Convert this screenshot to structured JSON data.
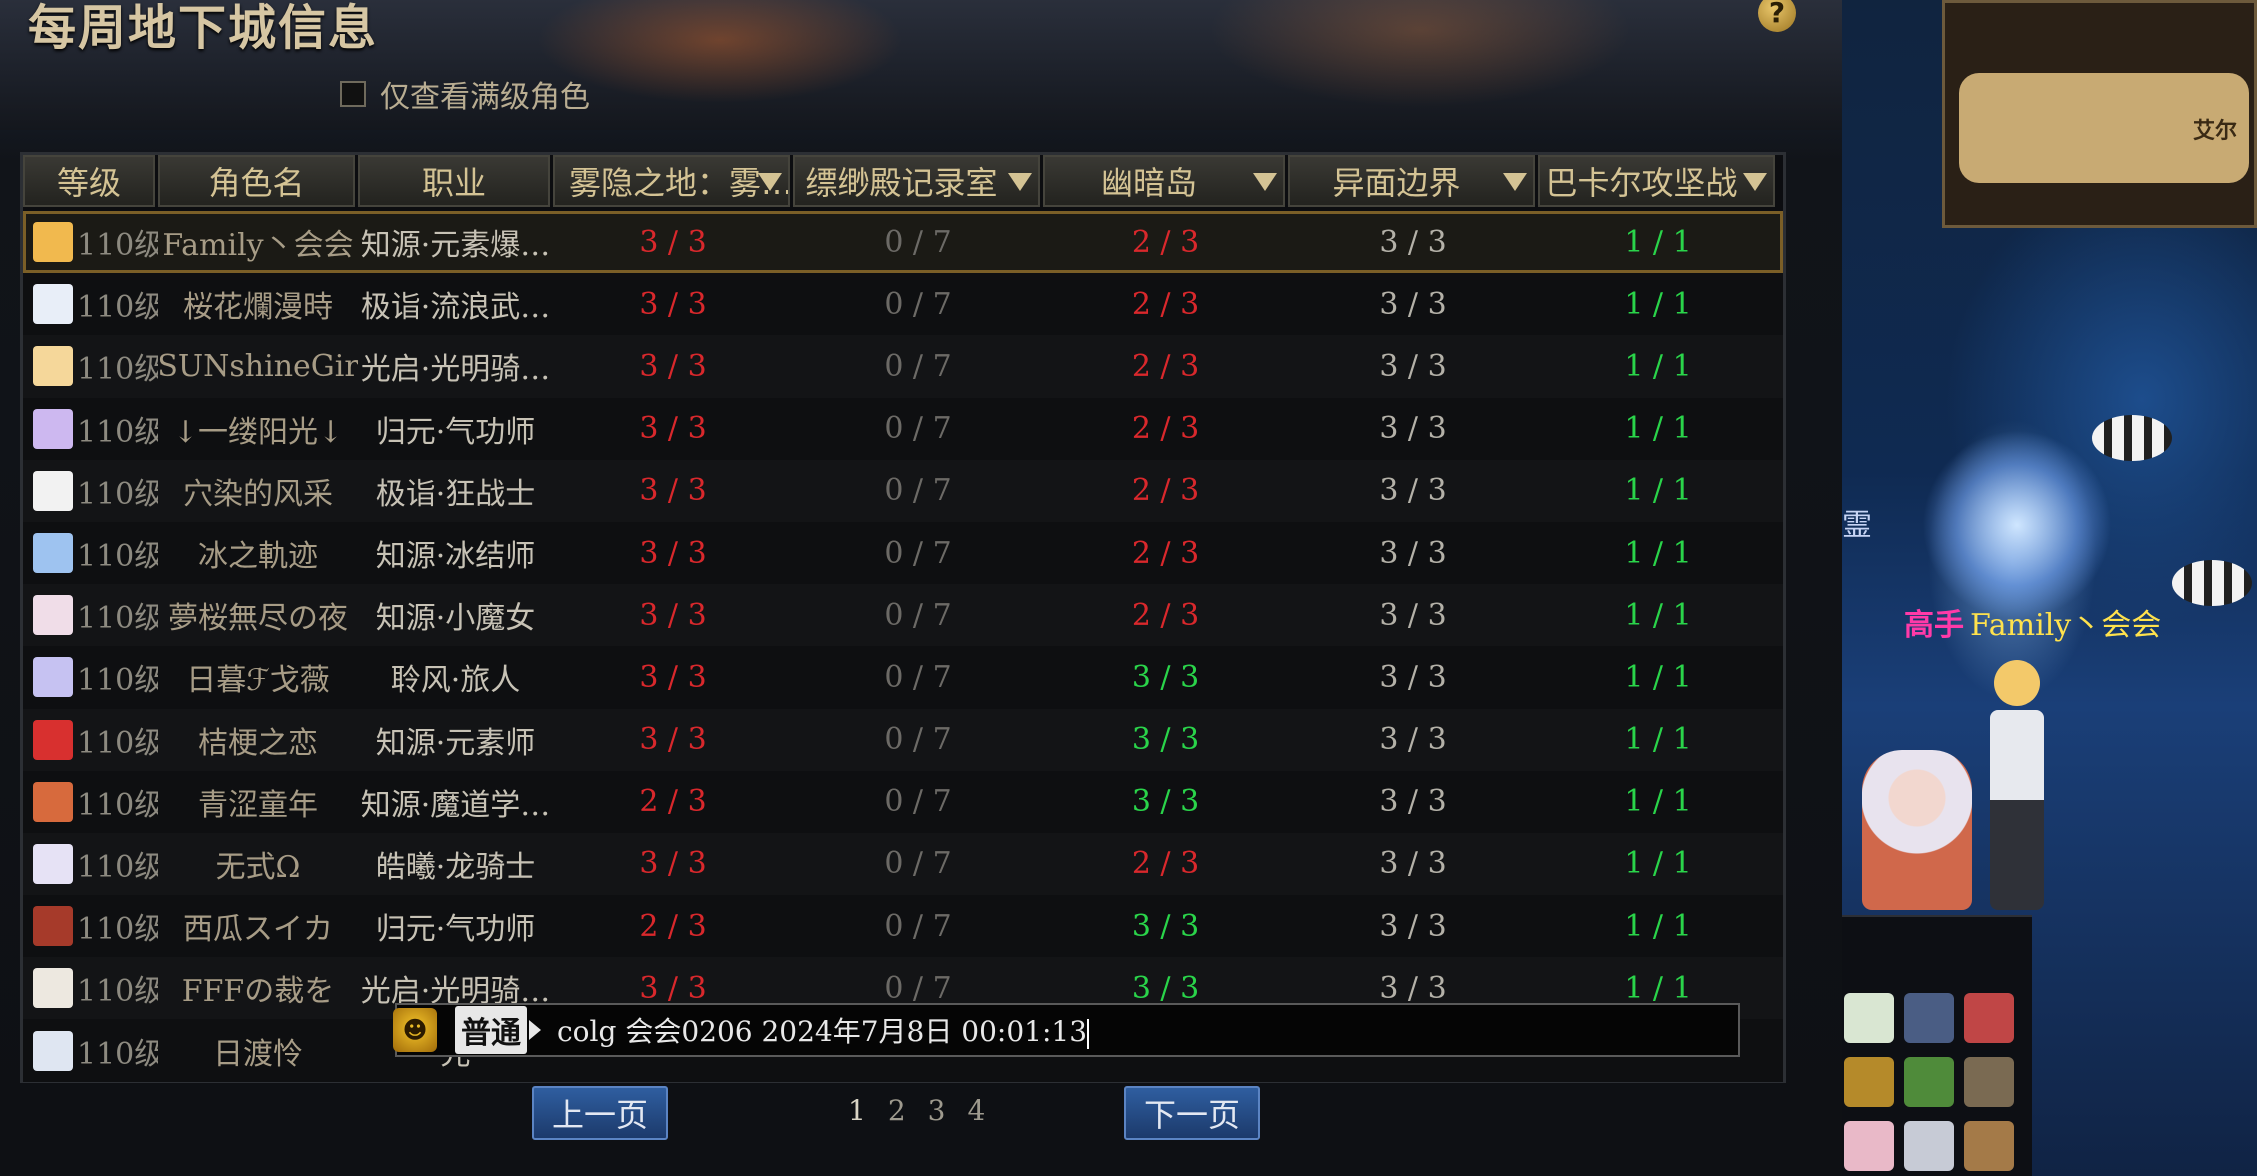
{
  "window": {
    "title": "每周地下城信息",
    "help_label": "?"
  },
  "filter": {
    "label": "仅查看满级角色",
    "checked": false
  },
  "table": {
    "columns": [
      {
        "label": "等级",
        "sortable": false
      },
      {
        "label": "角色名",
        "sortable": false
      },
      {
        "label": "职业",
        "sortable": false
      },
      {
        "label": "雾隐之地：雾…",
        "sortable": true
      },
      {
        "label": "缥缈殿记录室",
        "sortable": true
      },
      {
        "label": "幽暗岛",
        "sortable": true
      },
      {
        "label": "异面边界",
        "sortable": true
      },
      {
        "label": "巴卡尔攻坚战",
        "sortable": true
      }
    ],
    "rows": [
      {
        "level": "110级",
        "name": "Family丶会会",
        "job": "知源·元素爆…",
        "d1": "3 / 3",
        "d1c": "red",
        "d2": "0 / 7",
        "d3": "2 / 3",
        "d3c": "red",
        "d4": "3 / 3",
        "d5": "1 / 1",
        "avatar": "#f1b94e",
        "selected": true
      },
      {
        "level": "110级",
        "name": "桜花爛漫時",
        "job": "极诣·流浪武…",
        "d1": "3 / 3",
        "d1c": "red",
        "d2": "0 / 7",
        "d3": "2 / 3",
        "d3c": "red",
        "d4": "3 / 3",
        "d5": "1 / 1",
        "avatar": "#e8eef8"
      },
      {
        "level": "110级",
        "name": "SUNshineGir",
        "job": "光启·光明骑…",
        "d1": "3 / 3",
        "d1c": "red",
        "d2": "0 / 7",
        "d3": "2 / 3",
        "d3c": "red",
        "d4": "3 / 3",
        "d5": "1 / 1",
        "avatar": "#f5d79a"
      },
      {
        "level": "110级",
        "name": "↓一缕阳光↓",
        "job": "归元·气功师",
        "d1": "3 / 3",
        "d1c": "red",
        "d2": "0 / 7",
        "d3": "2 / 3",
        "d3c": "red",
        "d4": "3 / 3",
        "d5": "1 / 1",
        "avatar": "#cdb8f0"
      },
      {
        "level": "110级",
        "name": "穴染的风采",
        "job": "极诣·狂战士",
        "d1": "3 / 3",
        "d1c": "red",
        "d2": "0 / 7",
        "d3": "2 / 3",
        "d3c": "red",
        "d4": "3 / 3",
        "d5": "1 / 1",
        "avatar": "#f2f2f2"
      },
      {
        "level": "110级",
        "name": "冰之軌迹",
        "job": "知源·冰结师",
        "d1": "3 / 3",
        "d1c": "red",
        "d2": "0 / 7",
        "d3": "2 / 3",
        "d3c": "red",
        "d4": "3 / 3",
        "d5": "1 / 1",
        "avatar": "#9ec3f0"
      },
      {
        "level": "110级",
        "name": "夢桜無尽の夜",
        "job": "知源·小魔女",
        "d1": "3 / 3",
        "d1c": "red",
        "d2": "0 / 7",
        "d3": "2 / 3",
        "d3c": "red",
        "d4": "3 / 3",
        "d5": "1 / 1",
        "avatar": "#f0dde8"
      },
      {
        "level": "110级",
        "name": "日暮ℱ戈薇",
        "job": "聆风·旅人",
        "d1": "3 / 3",
        "d1c": "red",
        "d2": "0 / 7",
        "d3": "3 / 3",
        "d3c": "green",
        "d4": "3 / 3",
        "d5": "1 / 1",
        "avatar": "#c6c2f2"
      },
      {
        "level": "110级",
        "name": "桔梗之恋",
        "job": "知源·元素师",
        "d1": "3 / 3",
        "d1c": "red",
        "d2": "0 / 7",
        "d3": "3 / 3",
        "d3c": "green",
        "d4": "3 / 3",
        "d5": "1 / 1",
        "avatar": "#d8302f"
      },
      {
        "level": "110级",
        "name": "青涩童年",
        "job": "知源·魔道学…",
        "d1": "2 / 3",
        "d1c": "red",
        "d2": "0 / 7",
        "d3": "3 / 3",
        "d3c": "green",
        "d4": "3 / 3",
        "d5": "1 / 1",
        "avatar": "#d76a3d"
      },
      {
        "level": "110级",
        "name": "无式Ω",
        "job": "皓曦·龙骑士",
        "d1": "3 / 3",
        "d1c": "red",
        "d2": "0 / 7",
        "d3": "2 / 3",
        "d3c": "red",
        "d4": "3 / 3",
        "d5": "1 / 1",
        "avatar": "#e6e2f5"
      },
      {
        "level": "110级",
        "name": "西瓜スイカ",
        "job": "归元·气功师",
        "d1": "2 / 3",
        "d1c": "red",
        "d2": "0 / 7",
        "d3": "3 / 3",
        "d3c": "green",
        "d4": "3 / 3",
        "d5": "1 / 1",
        "avatar": "#a63a2a"
      },
      {
        "level": "110级",
        "name": "FFFの裁を",
        "job": "光启·光明骑…",
        "d1": "3 / 3",
        "d1c": "red",
        "d2": "0 / 7",
        "d3": "3 / 3",
        "d3c": "green",
        "d4": "3 / 3",
        "d5": "1 / 1",
        "avatar": "#ede8e0"
      },
      {
        "level": "110级",
        "name": "日渡怜",
        "job": "光",
        "d1": "",
        "d1c": "red",
        "d2": "",
        "d3": "",
        "d3c": "red",
        "d4": "",
        "d5": "",
        "avatar": "#dfe6f2"
      }
    ]
  },
  "pager": {
    "prev": "上一页",
    "next": "下一页",
    "pages": [
      "1",
      "2",
      "3",
      "4"
    ],
    "current": "1"
  },
  "chat": {
    "icon": "chat-emoji-icon",
    "channel": "普通",
    "text": "colg  会会0206  2024年7月8日  00:01:13"
  },
  "game": {
    "minimap_label": "艾尔",
    "side_label": "霊",
    "player_title": "高手",
    "player_name": "Family丶会会"
  }
}
